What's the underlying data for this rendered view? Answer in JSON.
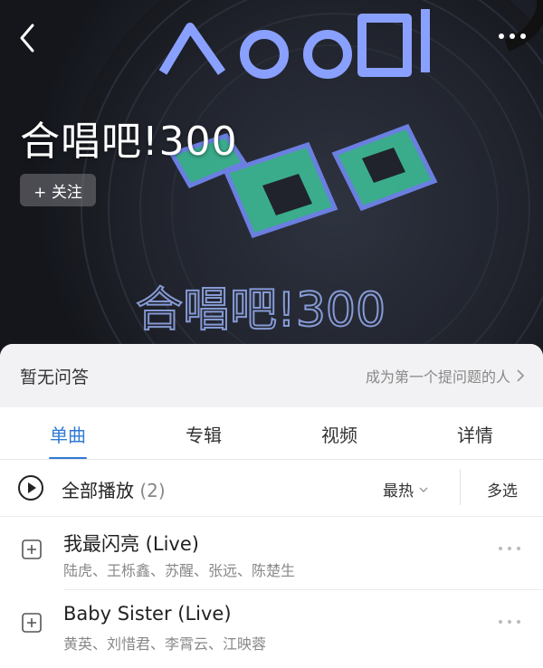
{
  "header": {
    "back_icon": "chevron-left-icon",
    "more_icon": "ellipsis-icon",
    "artist_name": "合唱吧!300",
    "follow_label": "+ 关注",
    "cover_text": "合唱吧!300"
  },
  "qa": {
    "title": "暂无问答",
    "link_label": "成为第一个提问题的人"
  },
  "tabs": [
    {
      "label": "单曲",
      "active": true
    },
    {
      "label": "专辑",
      "active": false
    },
    {
      "label": "视频",
      "active": false
    },
    {
      "label": "详情",
      "active": false
    }
  ],
  "playall": {
    "label": "全部播放",
    "count": "(2)",
    "sort_label": "最热",
    "multi_select_label": "多选"
  },
  "songs": [
    {
      "title": "我最闪亮 (Live)",
      "artists": "陆虎、王栎鑫、苏醒、张远、陈楚生"
    },
    {
      "title": "Baby Sister (Live)",
      "artists": "黄英、刘惜君、李霄云、江映蓉"
    }
  ],
  "colors": {
    "accent": "#2f7ad6",
    "hero_bg": "#1b1e26",
    "cover_green": "#3ec39a",
    "cover_blue": "#6a7fe0"
  }
}
